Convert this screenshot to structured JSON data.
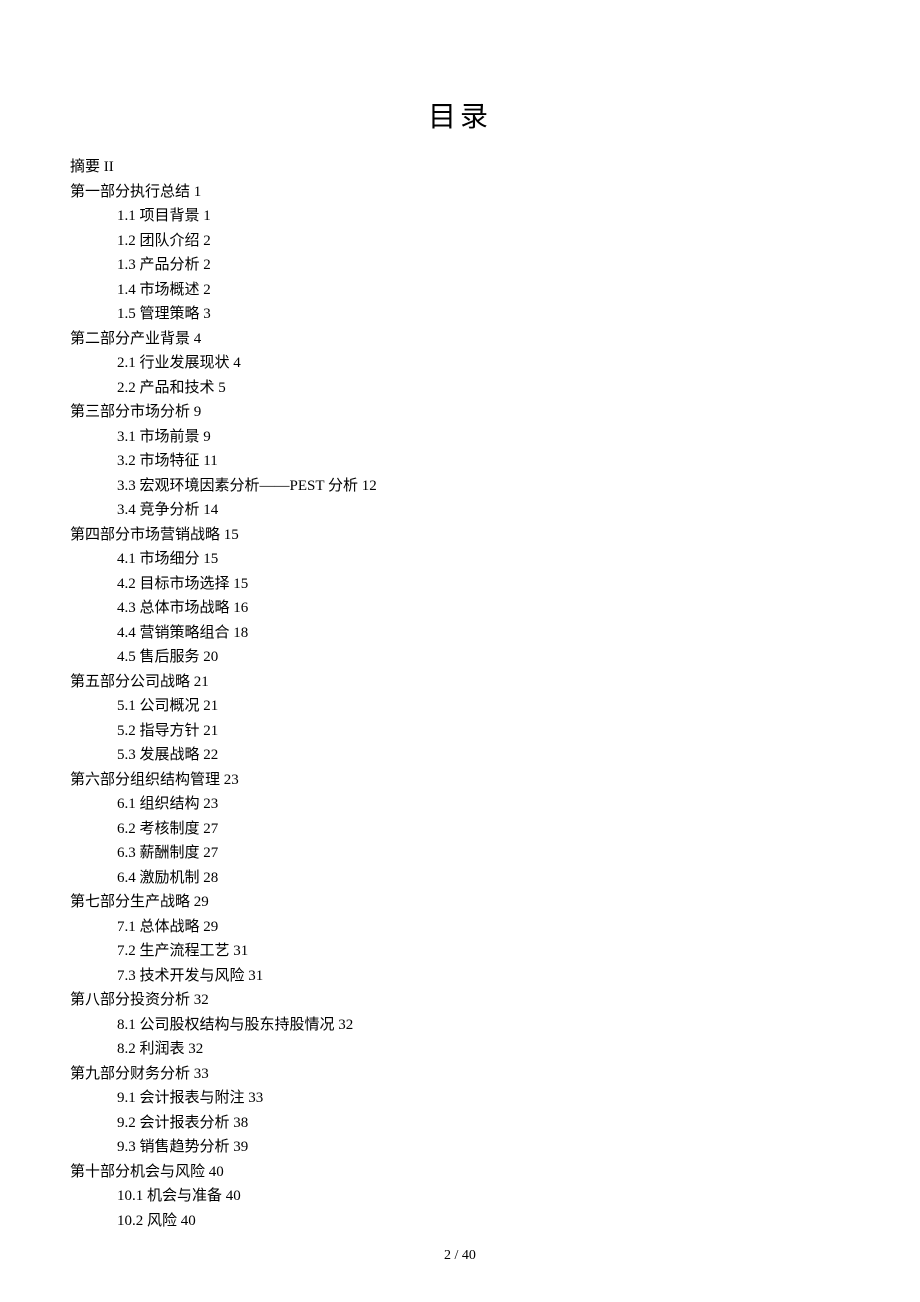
{
  "title": "目录",
  "entries": [
    {
      "level": 1,
      "text": "摘要 II"
    },
    {
      "level": 1,
      "text": "第一部分执行总结 1"
    },
    {
      "level": 2,
      "text": "1.1 项目背景 1"
    },
    {
      "level": 2,
      "text": "1.2 团队介绍 2"
    },
    {
      "level": 2,
      "text": "1.3 产品分析 2"
    },
    {
      "level": 2,
      "text": "1.4 市场概述 2"
    },
    {
      "level": 2,
      "text": "1.5 管理策略 3"
    },
    {
      "level": 1,
      "text": "第二部分产业背景 4"
    },
    {
      "level": 2,
      "text": "2.1 行业发展现状 4"
    },
    {
      "level": 2,
      "text": "2.2 产品和技术 5"
    },
    {
      "level": 1,
      "text": "第三部分市场分析 9"
    },
    {
      "level": 2,
      "text": "3.1 市场前景 9"
    },
    {
      "level": 2,
      "text": "3.2 市场特征 11"
    },
    {
      "level": 2,
      "text": "3.3 宏观环境因素分析——PEST 分析 12"
    },
    {
      "level": 2,
      "text": "3.4 竞争分析 14"
    },
    {
      "level": 1,
      "text": "第四部分市场营销战略 15"
    },
    {
      "level": 2,
      "text": "4.1 市场细分 15"
    },
    {
      "level": 2,
      "text": "4.2 目标市场选择 15"
    },
    {
      "level": 2,
      "text": "4.3 总体市场战略 16"
    },
    {
      "level": 2,
      "text": "4.4 营销策略组合 18"
    },
    {
      "level": 2,
      "text": "4.5 售后服务 20"
    },
    {
      "level": 1,
      "text": "第五部分公司战略 21"
    },
    {
      "level": 2,
      "text": "5.1 公司概况 21"
    },
    {
      "level": 2,
      "text": "5.2 指导方针 21"
    },
    {
      "level": 2,
      "text": "5.3 发展战略 22"
    },
    {
      "level": 1,
      "text": "第六部分组织结构管理 23"
    },
    {
      "level": 2,
      "text": "6.1 组织结构 23"
    },
    {
      "level": 2,
      "text": "6.2 考核制度 27"
    },
    {
      "level": 2,
      "text": "6.3 薪酬制度 27"
    },
    {
      "level": 2,
      "text": "6.4 激励机制 28"
    },
    {
      "level": 1,
      "text": "第七部分生产战略 29"
    },
    {
      "level": 2,
      "text": "7.1 总体战略 29"
    },
    {
      "level": 2,
      "text": "7.2 生产流程工艺 31"
    },
    {
      "level": 2,
      "text": "7.3 技术开发与风险 31"
    },
    {
      "level": 1,
      "text": "第八部分投资分析 32"
    },
    {
      "level": 2,
      "text": "8.1 公司股权结构与股东持股情况 32"
    },
    {
      "level": 2,
      "text": "8.2 利润表 32"
    },
    {
      "level": 1,
      "text": "第九部分财务分析 33"
    },
    {
      "level": 2,
      "text": "9.1 会计报表与附注 33"
    },
    {
      "level": 2,
      "text": "9.2 会计报表分析 38"
    },
    {
      "level": 2,
      "text": "9.3 销售趋势分析 39"
    },
    {
      "level": 1,
      "text": "第十部分机会与风险 40"
    },
    {
      "level": 2,
      "text": "10.1 机会与准备 40"
    },
    {
      "level": 2,
      "text": "10.2 风险 40"
    }
  ],
  "footer": "2 / 40"
}
